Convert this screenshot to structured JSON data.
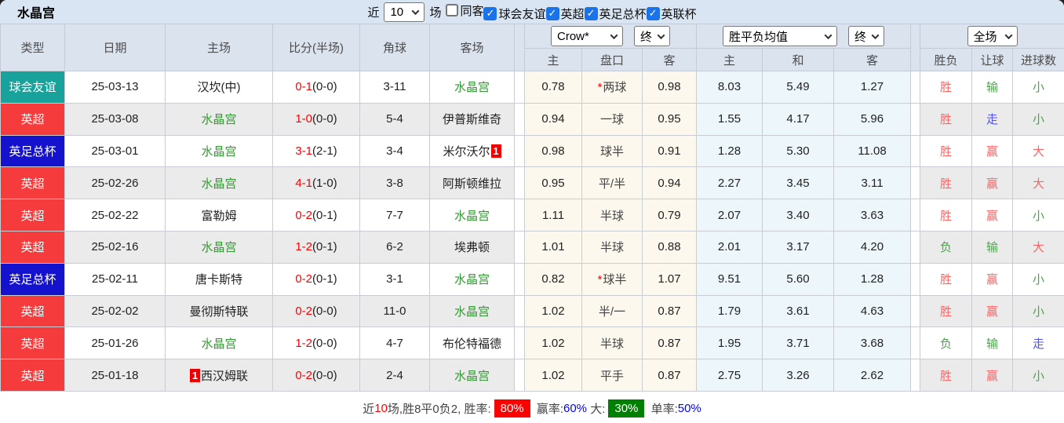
{
  "topbar": {
    "title": "水晶宫",
    "near_label": "近",
    "matches_count": "10",
    "matches_label": "场",
    "filters": [
      {
        "label": "同客",
        "checked": false
      },
      {
        "label": "球会友谊",
        "checked": true
      },
      {
        "label": "英超",
        "checked": true
      },
      {
        "label": "英足总杯",
        "checked": true
      },
      {
        "label": "英联杯",
        "checked": true
      }
    ]
  },
  "table": {
    "headers": {
      "type": "类型",
      "date": "日期",
      "home": "主场",
      "score": "比分(半场)",
      "corners": "角球",
      "away": "客场"
    },
    "dropdowns": {
      "company": "Crow*",
      "company_time": "终",
      "average": "胜平负均值",
      "average_time": "终",
      "scope": "全场"
    },
    "subheaders": {
      "h_home": "主",
      "h_line": "盘口",
      "h_away": "客",
      "e_home": "主",
      "e_draw": "和",
      "e_away": "客",
      "result": "胜负",
      "cover": "让球",
      "goals": "进球数"
    },
    "rows": [
      {
        "type": "球会友谊",
        "date": "25-03-13",
        "home": {
          "name": "汉坎(中)",
          "self": false
        },
        "score": "0-1",
        "half": "(0-0)",
        "corners": "3-11",
        "away": {
          "name": "水晶宫",
          "self": true
        },
        "handicap": {
          "home": "0.78",
          "star": true,
          "line": "两球",
          "away": "0.98"
        },
        "europe": {
          "home": "8.03",
          "draw": "5.49",
          "away": "1.27"
        },
        "result": {
          "text": "胜",
          "color": "red"
        },
        "cover": {
          "text": "输",
          "color": "green"
        },
        "goals": {
          "text": "小",
          "color": "green"
        }
      },
      {
        "type": "英超",
        "date": "25-03-08",
        "home": {
          "name": "水晶宫",
          "self": true
        },
        "score": "1-0",
        "half": "(0-0)",
        "corners": "5-4",
        "away": {
          "name": "伊普斯维奇",
          "self": false
        },
        "handicap": {
          "home": "0.94",
          "star": false,
          "line": "一球",
          "away": "0.95"
        },
        "europe": {
          "home": "1.55",
          "draw": "4.17",
          "away": "5.96"
        },
        "result": {
          "text": "胜",
          "color": "red"
        },
        "cover": {
          "text": "走",
          "color": "blue"
        },
        "goals": {
          "text": "小",
          "color": "green"
        }
      },
      {
        "type": "英足总杯",
        "date": "25-03-01",
        "home": {
          "name": "水晶宫",
          "self": true
        },
        "score": "3-1",
        "half": "(2-1)",
        "corners": "3-4",
        "away": {
          "name": "米尔沃尔",
          "self": false,
          "redcard_after": "1"
        },
        "handicap": {
          "home": "0.98",
          "star": false,
          "line": "球半",
          "away": "0.91"
        },
        "europe": {
          "home": "1.28",
          "draw": "5.30",
          "away": "11.08"
        },
        "result": {
          "text": "胜",
          "color": "red"
        },
        "cover": {
          "text": "赢",
          "color": "red"
        },
        "goals": {
          "text": "大",
          "color": "red"
        }
      },
      {
        "type": "英超",
        "date": "25-02-26",
        "home": {
          "name": "水晶宫",
          "self": true
        },
        "score": "4-1",
        "half": "(1-0)",
        "corners": "3-8",
        "away": {
          "name": "阿斯顿维拉",
          "self": false
        },
        "handicap": {
          "home": "0.95",
          "star": false,
          "line": "平/半",
          "away": "0.94"
        },
        "europe": {
          "home": "2.27",
          "draw": "3.45",
          "away": "3.11"
        },
        "result": {
          "text": "胜",
          "color": "red"
        },
        "cover": {
          "text": "赢",
          "color": "red"
        },
        "goals": {
          "text": "大",
          "color": "red"
        }
      },
      {
        "type": "英超",
        "date": "25-02-22",
        "home": {
          "name": "富勒姆",
          "self": false
        },
        "score": "0-2",
        "half": "(0-1)",
        "corners": "7-7",
        "away": {
          "name": "水晶宫",
          "self": true
        },
        "handicap": {
          "home": "1.11",
          "star": false,
          "line": "半球",
          "away": "0.79"
        },
        "europe": {
          "home": "2.07",
          "draw": "3.40",
          "away": "3.63"
        },
        "result": {
          "text": "胜",
          "color": "red"
        },
        "cover": {
          "text": "赢",
          "color": "red"
        },
        "goals": {
          "text": "小",
          "color": "green"
        }
      },
      {
        "type": "英超",
        "date": "25-02-16",
        "home": {
          "name": "水晶宫",
          "self": true
        },
        "score": "1-2",
        "half": "(0-1)",
        "corners": "6-2",
        "away": {
          "name": "埃弗顿",
          "self": false
        },
        "handicap": {
          "home": "1.01",
          "star": false,
          "line": "半球",
          "away": "0.88"
        },
        "europe": {
          "home": "2.01",
          "draw": "3.17",
          "away": "4.20"
        },
        "result": {
          "text": "负",
          "color": "green"
        },
        "cover": {
          "text": "输",
          "color": "green"
        },
        "goals": {
          "text": "大",
          "color": "red"
        }
      },
      {
        "type": "英足总杯",
        "date": "25-02-11",
        "home": {
          "name": "唐卡斯特",
          "self": false
        },
        "score": "0-2",
        "half": "(0-1)",
        "corners": "3-1",
        "away": {
          "name": "水晶宫",
          "self": true
        },
        "handicap": {
          "home": "0.82",
          "star": true,
          "line": "球半",
          "away": "1.07"
        },
        "europe": {
          "home": "9.51",
          "draw": "5.60",
          "away": "1.28"
        },
        "result": {
          "text": "胜",
          "color": "red"
        },
        "cover": {
          "text": "赢",
          "color": "red"
        },
        "goals": {
          "text": "小",
          "color": "green"
        }
      },
      {
        "type": "英超",
        "date": "25-02-02",
        "home": {
          "name": "曼彻斯特联",
          "self": false
        },
        "score": "0-2",
        "half": "(0-0)",
        "corners": "11-0",
        "away": {
          "name": "水晶宫",
          "self": true
        },
        "handicap": {
          "home": "1.02",
          "star": false,
          "line": "半/一",
          "away": "0.87"
        },
        "europe": {
          "home": "1.79",
          "draw": "3.61",
          "away": "4.63"
        },
        "result": {
          "text": "胜",
          "color": "red"
        },
        "cover": {
          "text": "赢",
          "color": "red"
        },
        "goals": {
          "text": "小",
          "color": "green"
        }
      },
      {
        "type": "英超",
        "date": "25-01-26",
        "home": {
          "name": "水晶宫",
          "self": true
        },
        "score": "1-2",
        "half": "(0-0)",
        "corners": "4-7",
        "away": {
          "name": "布伦特福德",
          "self": false
        },
        "handicap": {
          "home": "1.02",
          "star": false,
          "line": "半球",
          "away": "0.87"
        },
        "europe": {
          "home": "1.95",
          "draw": "3.71",
          "away": "3.68"
        },
        "result": {
          "text": "负",
          "color": "green"
        },
        "cover": {
          "text": "输",
          "color": "green"
        },
        "goals": {
          "text": "走",
          "color": "blue"
        }
      },
      {
        "type": "英超",
        "date": "25-01-18",
        "home": {
          "name": "西汉姆联",
          "self": false,
          "redcard_before": "1"
        },
        "score": "0-2",
        "half": "(0-0)",
        "corners": "2-4",
        "away": {
          "name": "水晶宫",
          "self": true
        },
        "handicap": {
          "home": "1.02",
          "star": false,
          "line": "平手",
          "away": "0.87"
        },
        "europe": {
          "home": "2.75",
          "draw": "3.26",
          "away": "2.62"
        },
        "result": {
          "text": "胜",
          "color": "red"
        },
        "cover": {
          "text": "赢",
          "color": "red"
        },
        "goals": {
          "text": "小",
          "color": "green"
        }
      }
    ]
  },
  "summary": {
    "segments": [
      {
        "text": "近",
        "style": "plain"
      },
      {
        "text": "10",
        "style": "red-text"
      },
      {
        "text": "场,胜8平0负2, 胜率:",
        "style": "plain"
      },
      {
        "text": "80%",
        "style": "red-badge"
      },
      {
        "text": " 赢率:",
        "style": "plain"
      },
      {
        "text": "60%",
        "style": "blue-text"
      },
      {
        "text": " 大:",
        "style": "plain"
      },
      {
        "text": "30%",
        "style": "green-badge"
      },
      {
        "text": " 单率:",
        "style": "plain"
      },
      {
        "text": "50%",
        "style": "blue-text"
      }
    ]
  },
  "colors": {
    "type_badges": {
      "球会友谊": "#17a29b",
      "英超": "#f53b3b",
      "英足总杯": "#1412cc"
    },
    "results": {
      "red": "#ff6363",
      "green": "#4aa54a",
      "blue": "#5252fa"
    },
    "team_highlight": "#339933",
    "score_red": "#ff0000",
    "checkbox_blue": "#1a73e8",
    "summary_win_badge": "#ff0000",
    "summary_big_badge": "#008000",
    "summary_rate_text": "#0000ff"
  }
}
